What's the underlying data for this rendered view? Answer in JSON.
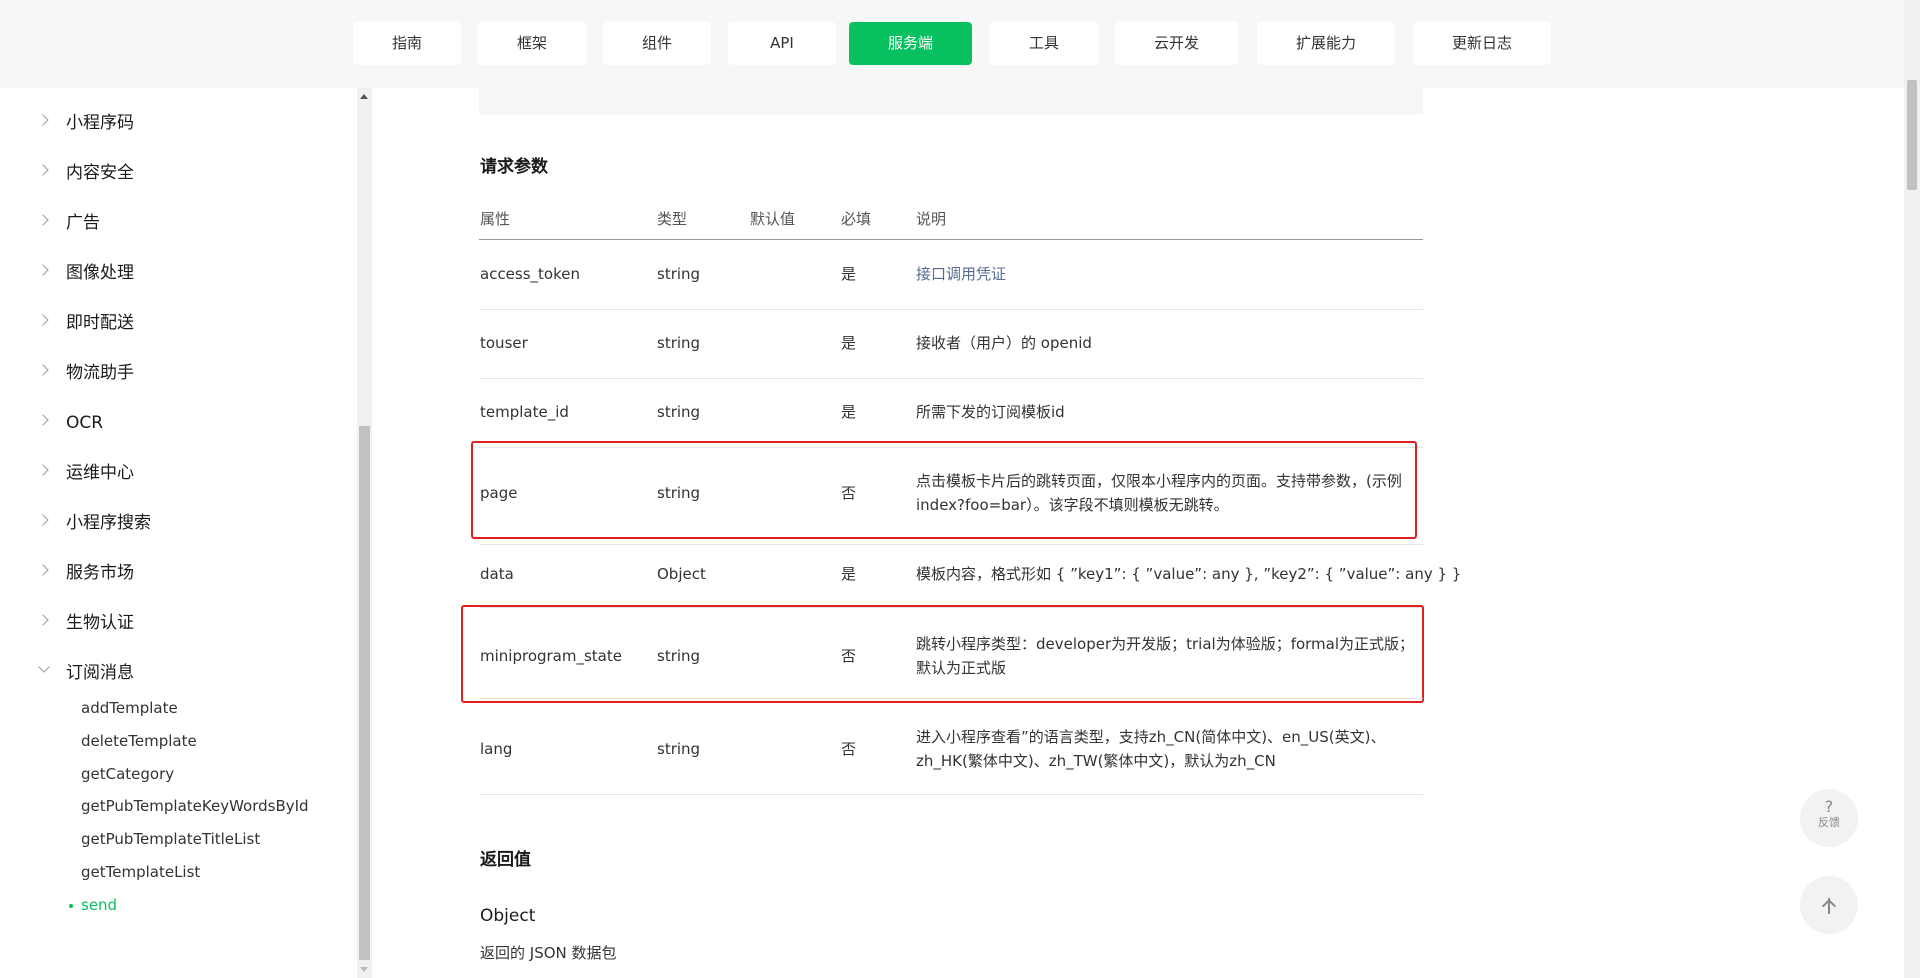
{
  "topnav": {
    "tabs": [
      {
        "label": "指南"
      },
      {
        "label": "框架"
      },
      {
        "label": "组件"
      },
      {
        "label": "API"
      },
      {
        "label": "服务端",
        "active": true
      },
      {
        "label": "工具"
      },
      {
        "label": "云开发"
      },
      {
        "label": "扩展能力"
      },
      {
        "label": "更新日志"
      }
    ],
    "accent_color": "#07c160"
  },
  "sidebar": {
    "items": [
      {
        "label": "小程序码"
      },
      {
        "label": "内容安全"
      },
      {
        "label": "广告"
      },
      {
        "label": "图像处理"
      },
      {
        "label": "即时配送"
      },
      {
        "label": "物流助手"
      },
      {
        "label": "OCR"
      },
      {
        "label": "运维中心"
      },
      {
        "label": "小程序搜索"
      },
      {
        "label": "服务市场"
      },
      {
        "label": "生物认证"
      },
      {
        "label": "订阅消息",
        "expanded": true
      }
    ],
    "sub_items": [
      {
        "label": "addTemplate"
      },
      {
        "label": "deleteTemplate"
      },
      {
        "label": "getCategory"
      },
      {
        "label": "getPubTemplateKeyWordsById"
      },
      {
        "label": "getPubTemplateTitleList"
      },
      {
        "label": "getTemplateList"
      },
      {
        "label": "send",
        "active": true
      }
    ]
  },
  "main": {
    "request_params_title": "请求参数",
    "table": {
      "headers": [
        "属性",
        "类型",
        "默认值",
        "必填",
        "说明"
      ],
      "rows": [
        {
          "name": "access_token",
          "type": "string",
          "default": "",
          "required": "是",
          "desc": "接口调用凭证",
          "desc_is_link": true
        },
        {
          "name": "touser",
          "type": "string",
          "default": "",
          "required": "是",
          "desc": "接收者（用户）的 openid"
        },
        {
          "name": "template_id",
          "type": "string",
          "default": "",
          "required": "是",
          "desc": "所需下发的订阅模板id"
        },
        {
          "name": "page",
          "type": "string",
          "default": "",
          "required": "否",
          "desc_line1": "点击模板卡片后的跳转页面，仅限本小程序内的页面。支持带参数，(示例",
          "desc_line2": "index?foo=bar）。该字段不填则模板无跳转。",
          "highlighted": true
        },
        {
          "name": "data",
          "type": "Object",
          "default": "",
          "required": "是",
          "desc": "模板内容，格式形如 { ”key1”: { ”value”: any }, ”key2”: { ”value”: any } }"
        },
        {
          "name": "miniprogram_state",
          "type": "string",
          "default": "",
          "required": "否",
          "desc_line1": "跳转小程序类型：developer为开发版；trial为体验版；formal为正式版；",
          "desc_line2": "默认为正式版",
          "highlighted": true
        },
        {
          "name": "lang",
          "type": "string",
          "default": "",
          "required": "否",
          "desc_line1": "进入小程序查看”的语言类型，支持zh_CN(简体中文)、en_US(英文)、",
          "desc_line2": "zh_HK(繁体中文)、zh_TW(繁体中文)，默认为zh_CN"
        }
      ]
    },
    "return_title": "返回值",
    "object_title": "Object",
    "object_desc": "返回的 JSON 数据包",
    "highlight_color": "#e02020"
  },
  "float_buttons": {
    "feedback_icon": "?",
    "feedback_label": "反馈",
    "back_to_top_icon": "arrow-up-icon"
  }
}
